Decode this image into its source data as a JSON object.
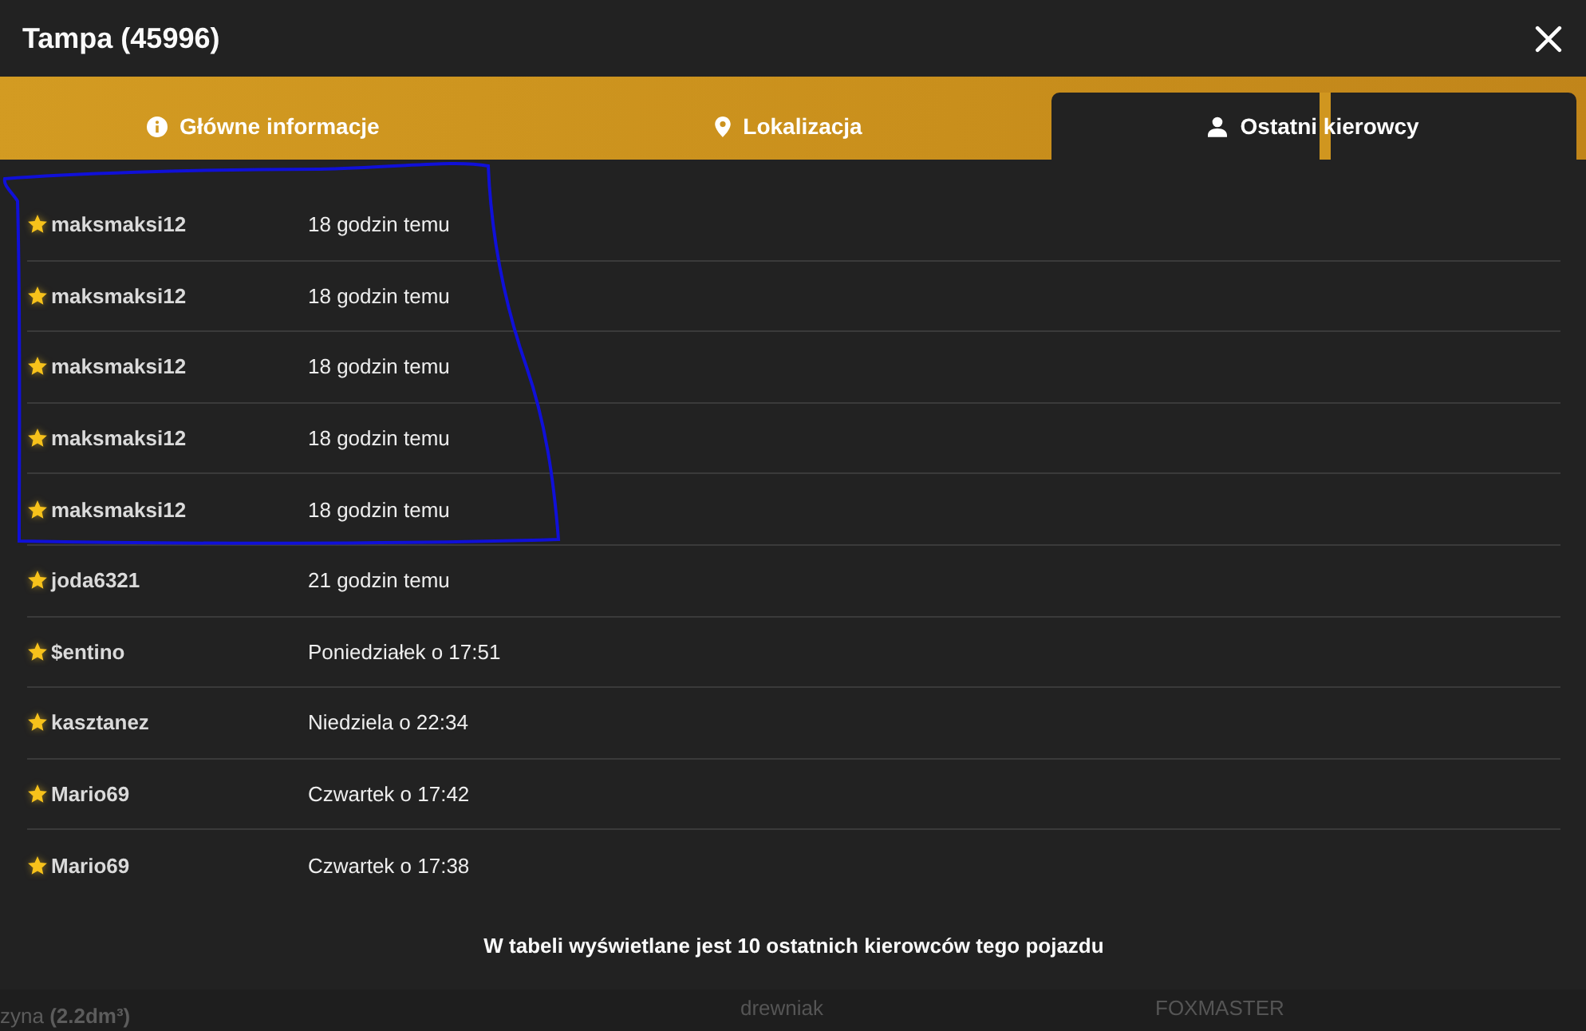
{
  "window": {
    "title": "Tampa (45996)"
  },
  "tabs": [
    {
      "label": "Główne informacje",
      "selected": false
    },
    {
      "label": "Lokalizacja",
      "selected": false
    },
    {
      "label": "Ostatni kierowcy",
      "selected": true
    }
  ],
  "drivers": [
    {
      "name": "maksmaksi12",
      "time": "18 godzin temu"
    },
    {
      "name": "maksmaksi12",
      "time": "18 godzin temu"
    },
    {
      "name": "maksmaksi12",
      "time": "18 godzin temu"
    },
    {
      "name": "maksmaksi12",
      "time": "18 godzin temu"
    },
    {
      "name": "maksmaksi12",
      "time": "18 godzin temu"
    },
    {
      "name": "joda6321",
      "time": "21 godzin temu"
    },
    {
      "name": "$entino",
      "time": "Poniedziałek o 17:51"
    },
    {
      "name": "kasztanez",
      "time": "Niedziela o 22:34"
    },
    {
      "name": "Mario69",
      "time": "Czwartek o 17:42"
    },
    {
      "name": "Mario69",
      "time": "Czwartek o 17:38"
    }
  ],
  "note": "W tabeli wyświetlane jest 10 ostatnich kierowców tego pojazdu",
  "background_cells": [
    "zyna **(2.2dm³)**",
    "drewniak",
    "FOXMASTER"
  ]
}
